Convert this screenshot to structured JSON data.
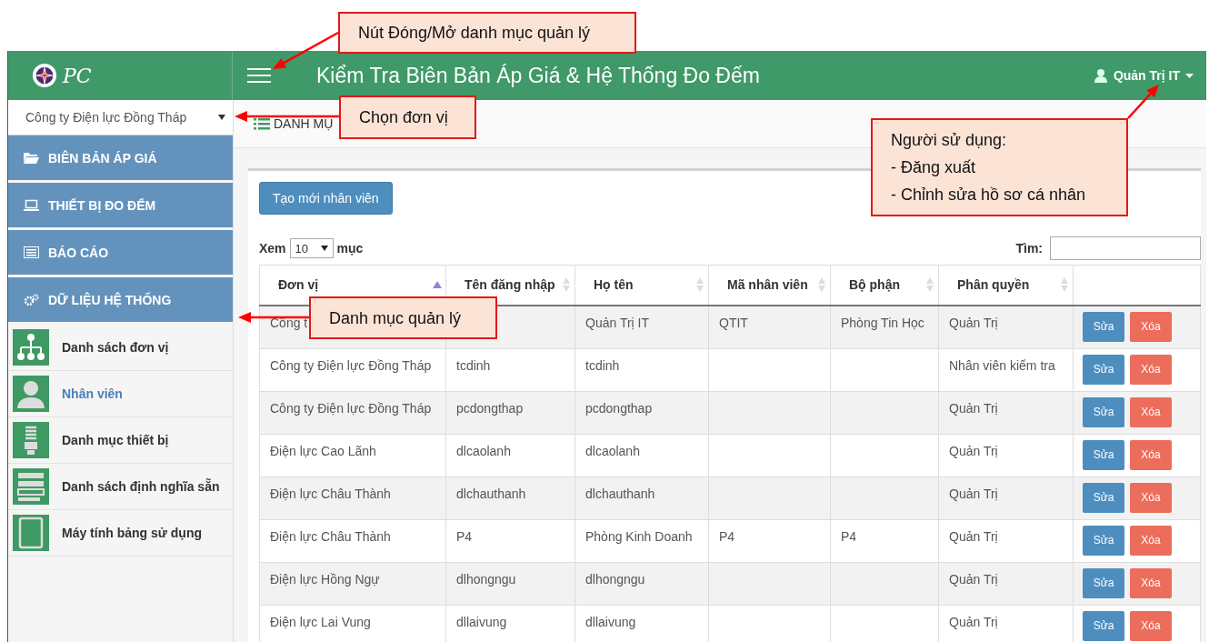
{
  "header": {
    "logo_text": "PC",
    "title": "Kiểm Tra Biên Bản Áp Giá & Hệ Thống Đo Đếm",
    "user": "Quản Trị IT"
  },
  "sidebar": {
    "unit_select": "Công ty Điện lực Đồng Tháp",
    "menu": [
      {
        "label": "BIÊN BẢN ÁP GIÁ"
      },
      {
        "label": "THIẾT BỊ ĐO ĐẾM"
      },
      {
        "label": "BÁO CÁO"
      },
      {
        "label": "DỮ LIỆU HỆ THỐNG"
      }
    ],
    "submenu": [
      {
        "label": "Danh sách đơn vị",
        "selected": false
      },
      {
        "label": "Nhân viên",
        "selected": true
      },
      {
        "label": "Danh mục thiết bị",
        "selected": false
      },
      {
        "label": "Danh sách định nghĩa sẵn",
        "selected": false
      },
      {
        "label": "Máy tính bảng sử dụng",
        "selected": false
      }
    ]
  },
  "breadcrumb": "DANH MỤ",
  "create_button": "Tạo mới nhân viên",
  "length": {
    "prefix": "Xem",
    "value": "10",
    "suffix": "mục"
  },
  "search": {
    "label": "Tìm:"
  },
  "table": {
    "columns": [
      "Đơn vị",
      "Tên đăng nhập",
      "Họ tên",
      "Mã nhân viên",
      "Bộ phận",
      "Phân quyền"
    ],
    "rows": [
      {
        "cells": [
          "Công t",
          "",
          "Quản Trị IT",
          "QTIT",
          "Phòng Tin Học",
          "Quản Trị"
        ],
        "actions": [
          "Sửa",
          "Xóa"
        ]
      },
      {
        "cells": [
          "Công ty Điện lực Đồng Tháp",
          "tcdinh",
          "tcdinh",
          "",
          "",
          "Nhân viên kiểm tra"
        ],
        "actions": [
          "Sửa",
          "Xóa"
        ]
      },
      {
        "cells": [
          "Công ty Điện lực Đồng Tháp",
          "pcdongthap",
          "pcdongthap",
          "",
          "",
          "Quản Trị"
        ],
        "actions": [
          "Sửa",
          "Xóa"
        ]
      },
      {
        "cells": [
          "Điện lực Cao Lãnh",
          "dlcaolanh",
          "dlcaolanh",
          "",
          "",
          "Quản Trị"
        ],
        "actions": [
          "Sửa",
          "Xóa"
        ]
      },
      {
        "cells": [
          "Điện lực Châu Thành",
          "dlchauthanh",
          "dlchauthanh",
          "",
          "",
          "Quản Trị"
        ],
        "actions": [
          "Sửa",
          "Xóa"
        ]
      },
      {
        "cells": [
          "Điện lực Châu Thành",
          "P4",
          "Phòng Kinh Doanh",
          "P4",
          "P4",
          "Quản Trị"
        ],
        "actions": [
          "Sửa",
          "Xóa"
        ]
      },
      {
        "cells": [
          "Điện lực Hồng Ngự",
          "dlhongngu",
          "dlhongngu",
          "",
          "",
          "Quản Trị"
        ],
        "actions": [
          "Sửa",
          "Xóa"
        ]
      },
      {
        "cells": [
          "Điện lực Lai Vung",
          "dllaivung",
          "dllaivung",
          "",
          "",
          "Quản Trị"
        ],
        "actions": [
          "Sửa",
          "Xóa"
        ]
      }
    ]
  },
  "callouts": [
    [
      "Nút Đóng/Mở danh mục quản lý"
    ],
    [
      "Chọn đơn vị"
    ],
    [
      "Người sử dụng:",
      "- Đăng xuất",
      "- Chỉnh sửa hồ sơ cá nhân"
    ],
    [
      "Danh mục quản lý"
    ]
  ]
}
